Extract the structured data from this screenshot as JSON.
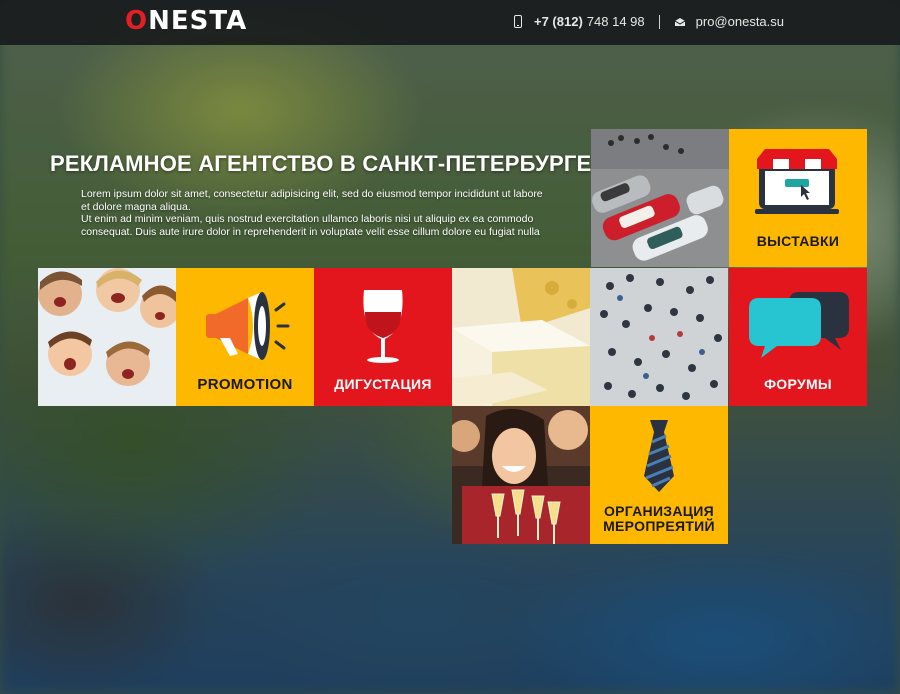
{
  "header": {
    "logo_first": "O",
    "logo_rest": "NESTA",
    "phone_code": "+7 (812)",
    "phone_number": "748 14 98",
    "email": "pro@onesta.su",
    "icons": [
      "phone-icon",
      "mail-icon"
    ]
  },
  "hero": {
    "title": "РЕКЛАМНОЕ АГЕНТСТВО В САНКТ-ПЕТЕРБУРГЕ",
    "paragraph1": "Lorem ipsum dolor sit amet, consectetur adipisicing elit, sed do eiusmod tempor incididunt ut labore et dolore magna aliqua.",
    "paragraph2": "Ut enim ad minim veniam, quis nostrud exercitation ullamco laboris nisi ut aliquip ex ea commodo consequat. Duis aute irure dolor in reprehenderit in voluptate velit esse cillum dolore eu fugiat nulla"
  },
  "tiles": {
    "vystavki": "ВЫСТАВКИ",
    "promotion": "PROMOTION",
    "degustaciya": "ДИГУСТАЦИЯ",
    "forumy": "ФОРУМЫ",
    "organizaciya_line1": "ОРГАНИЗАЦИЯ",
    "organizaciya_line2": "МЕРОПРЕЯТИЙ"
  },
  "colors": {
    "brand_red": "#e3151d",
    "brand_yellow": "#feb800",
    "header_bg": "#16181a"
  }
}
